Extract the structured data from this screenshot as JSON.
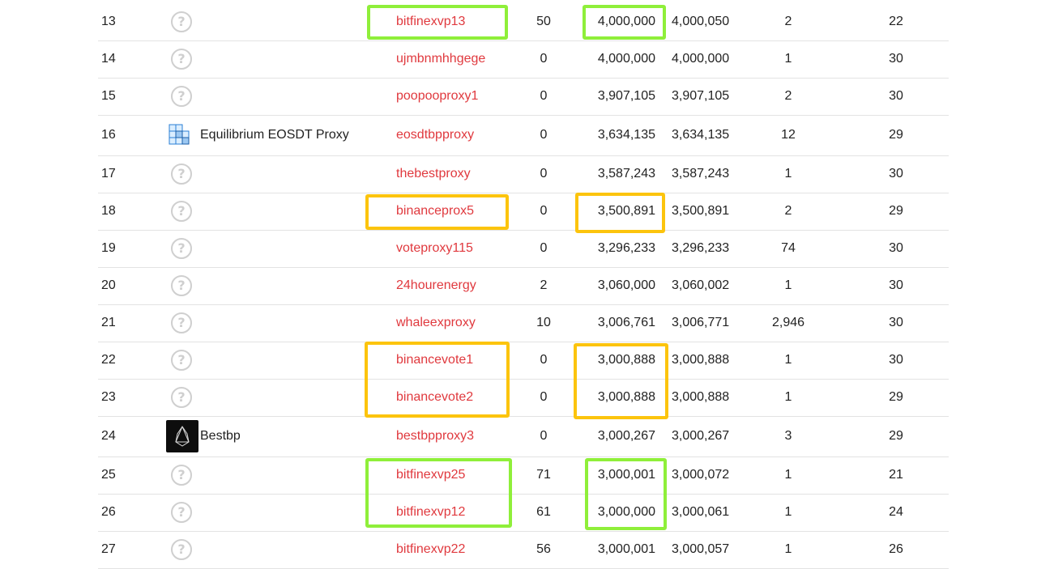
{
  "proxies": [
    {
      "rank": "13",
      "logo": "question",
      "org": "",
      "account": "bitfinexvp13",
      "staked": "50",
      "proxied": "4,000,000",
      "total": "4,000,050",
      "voters": "2",
      "producers": "22"
    },
    {
      "rank": "14",
      "logo": "question",
      "org": "",
      "account": "ujmbnmhhgege",
      "staked": "0",
      "proxied": "4,000,000",
      "total": "4,000,000",
      "voters": "1",
      "producers": "30"
    },
    {
      "rank": "15",
      "logo": "question",
      "org": "",
      "account": "poopooproxy1",
      "staked": "0",
      "proxied": "3,907,105",
      "total": "3,907,105",
      "voters": "2",
      "producers": "30"
    },
    {
      "rank": "16",
      "logo": "cube",
      "org": "Equilibrium EOSDT Proxy",
      "account": "eosdtbpproxy",
      "staked": "0",
      "proxied": "3,634,135",
      "total": "3,634,135",
      "voters": "12",
      "producers": "29"
    },
    {
      "rank": "17",
      "logo": "question",
      "org": "",
      "account": "thebestproxy",
      "staked": "0",
      "proxied": "3,587,243",
      "total": "3,587,243",
      "voters": "1",
      "producers": "30"
    },
    {
      "rank": "18",
      "logo": "question",
      "org": "",
      "account": "binanceprox5",
      "staked": "0",
      "proxied": "3,500,891",
      "total": "3,500,891",
      "voters": "2",
      "producers": "29"
    },
    {
      "rank": "19",
      "logo": "question",
      "org": "",
      "account": "voteproxy115",
      "staked": "0",
      "proxied": "3,296,233",
      "total": "3,296,233",
      "voters": "74",
      "producers": "30"
    },
    {
      "rank": "20",
      "logo": "question",
      "org": "",
      "account": "24hourenergy",
      "staked": "2",
      "proxied": "3,060,000",
      "total": "3,060,002",
      "voters": "1",
      "producers": "30"
    },
    {
      "rank": "21",
      "logo": "question",
      "org": "",
      "account": "whaleexproxy",
      "staked": "10",
      "proxied": "3,006,761",
      "total": "3,006,771",
      "voters": "2,946",
      "producers": "30"
    },
    {
      "rank": "22",
      "logo": "question",
      "org": "",
      "account": "binancevote1",
      "staked": "0",
      "proxied": "3,000,888",
      "total": "3,000,888",
      "voters": "1",
      "producers": "30"
    },
    {
      "rank": "23",
      "logo": "question",
      "org": "",
      "account": "binancevote2",
      "staked": "0",
      "proxied": "3,000,888",
      "total": "3,000,888",
      "voters": "1",
      "producers": "29"
    },
    {
      "rank": "24",
      "logo": "eos",
      "org": "Bestbp",
      "account": "bestbpproxy3",
      "staked": "0",
      "proxied": "3,000,267",
      "total": "3,000,267",
      "voters": "3",
      "producers": "29"
    },
    {
      "rank": "25",
      "logo": "question",
      "org": "",
      "account": "bitfinexvp25",
      "staked": "71",
      "proxied": "3,000,001",
      "total": "3,000,072",
      "voters": "1",
      "producers": "21"
    },
    {
      "rank": "26",
      "logo": "question",
      "org": "",
      "account": "bitfinexvp12",
      "staked": "61",
      "proxied": "3,000,000",
      "total": "3,000,061",
      "voters": "1",
      "producers": "24"
    },
    {
      "rank": "27",
      "logo": "question",
      "org": "",
      "account": "bitfinexvp22",
      "staked": "56",
      "proxied": "3,000,001",
      "total": "3,000,057",
      "voters": "1",
      "producers": "26"
    }
  ],
  "icons": {
    "question": "question-circle-icon",
    "cube": "equilibrium-cube-logo",
    "eos": "eos-logo"
  },
  "colors": {
    "account_link": "#e0393e",
    "highlight_green": "#8fef3a",
    "highlight_orange": "#fcc40d"
  }
}
